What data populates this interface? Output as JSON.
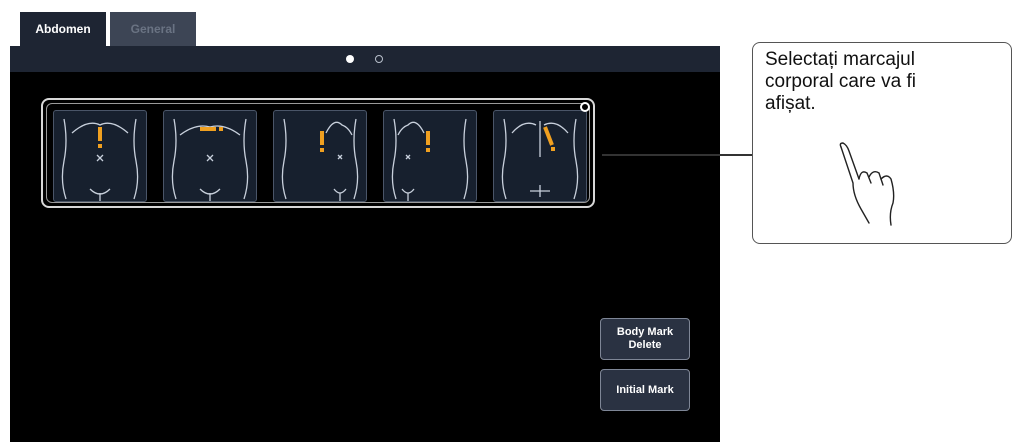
{
  "tabs": [
    {
      "label": "Abdomen",
      "active": true
    },
    {
      "label": "General",
      "active": false
    }
  ],
  "pager": {
    "pages": 2,
    "current": 1
  },
  "body_marks": [
    {
      "name": "body-mark-1",
      "icon": "abdomen-probe-upper-left-icon"
    },
    {
      "name": "body-mark-2",
      "icon": "abdomen-probe-upper-horizontal-icon"
    },
    {
      "name": "body-mark-3",
      "icon": "abdomen-probe-right-icon"
    },
    {
      "name": "body-mark-4",
      "icon": "abdomen-probe-left-icon"
    },
    {
      "name": "body-mark-5",
      "icon": "abdomen-probe-oblique-icon"
    }
  ],
  "buttons": {
    "body_mark_delete": "Body Mark\nDelete",
    "initial_mark": "Initial Mark"
  },
  "callout": {
    "text": "Selectați marcajul\ncorporal care va fi\nafișat."
  },
  "colors": {
    "probe": "#f0a020",
    "screen": "#000000",
    "tab_active": "#1e2533"
  }
}
